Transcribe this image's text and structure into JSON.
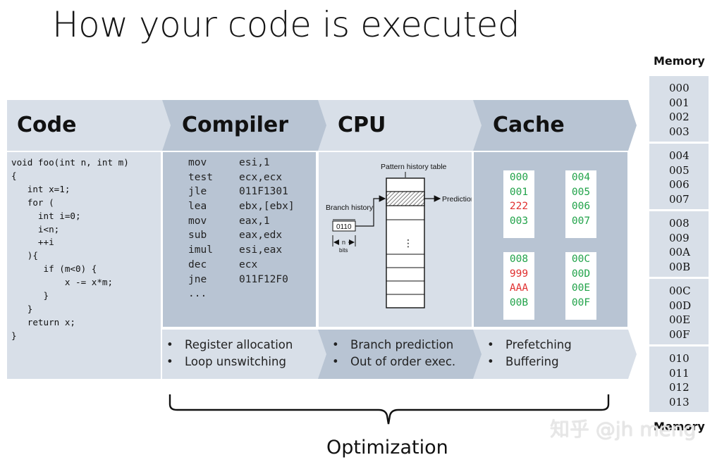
{
  "title": "How your code is executed",
  "headers": {
    "code": "Code",
    "compiler": "Compiler",
    "cpu": "CPU",
    "cache": "Cache"
  },
  "code_snippet": "void foo(int n, int m)\n{\n   int x=1;\n   for (\n     int i=0;\n     i<n;\n     ++i\n   ){\n      if (m<0) {\n          x -= x*m;\n      }\n   }\n   return x;\n}",
  "compiler_asm": [
    {
      "op": "mov",
      "args": "esi,1"
    },
    {
      "op": "test",
      "args": "ecx,ecx"
    },
    {
      "op": "jle",
      "args": "011F1301"
    },
    {
      "op": "lea",
      "args": "ebx,[ebx]"
    },
    {
      "op": "mov",
      "args": "eax,1"
    },
    {
      "op": "sub",
      "args": "eax,edx"
    },
    {
      "op": "imul",
      "args": "esi,eax"
    },
    {
      "op": "dec",
      "args": "ecx"
    },
    {
      "op": "jne",
      "args": "011F12F0"
    },
    {
      "op": "...",
      "args": ""
    }
  ],
  "cpu_diagram": {
    "table_label": "Pattern history table",
    "history_label": "Branch history",
    "history_value": "0110",
    "n_label": "n",
    "bits_label": "bits",
    "prediction_label": "Prediction",
    "ellipsis": "⋮"
  },
  "cache_lines": [
    [
      {
        "v": "000",
        "c": "green"
      },
      {
        "v": "001",
        "c": "green"
      },
      {
        "v": "222",
        "c": "red"
      },
      {
        "v": "003",
        "c": "green"
      }
    ],
    [
      {
        "v": "004",
        "c": "green"
      },
      {
        "v": "005",
        "c": "green"
      },
      {
        "v": "006",
        "c": "green"
      },
      {
        "v": "007",
        "c": "green"
      }
    ],
    [
      {
        "v": "008",
        "c": "green"
      },
      {
        "v": "999",
        "c": "red"
      },
      {
        "v": "AAA",
        "c": "red"
      },
      {
        "v": "00B",
        "c": "green"
      }
    ],
    [
      {
        "v": "00C",
        "c": "green"
      },
      {
        "v": "00D",
        "c": "green"
      },
      {
        "v": "00E",
        "c": "green"
      },
      {
        "v": "00F",
        "c": "green"
      }
    ]
  ],
  "footer_bullets": {
    "compiler": [
      "Register allocation",
      "Loop unswitching"
    ],
    "cpu": [
      "Branch prediction",
      "Out of order exec."
    ],
    "cache": [
      "Prefetching",
      "Buffering"
    ]
  },
  "memory": {
    "label_top": "Memory",
    "label_bottom": "Memory",
    "blocks": [
      [
        "000",
        "001",
        "002",
        "003"
      ],
      [
        "004",
        "005",
        "006",
        "007"
      ],
      [
        "008",
        "009",
        "00A",
        "00B"
      ],
      [
        "00C",
        "00D",
        "00E",
        "00F"
      ],
      [
        "010",
        "011",
        "012",
        "013"
      ]
    ]
  },
  "optimization_label": "Optimization",
  "watermark": "知乎 @jh meng",
  "colors": {
    "panel_light": "#d8dfe8",
    "panel_dark": "#b8c4d3",
    "cache_ok": "#22a34a",
    "cache_dirty": "#e03030"
  }
}
